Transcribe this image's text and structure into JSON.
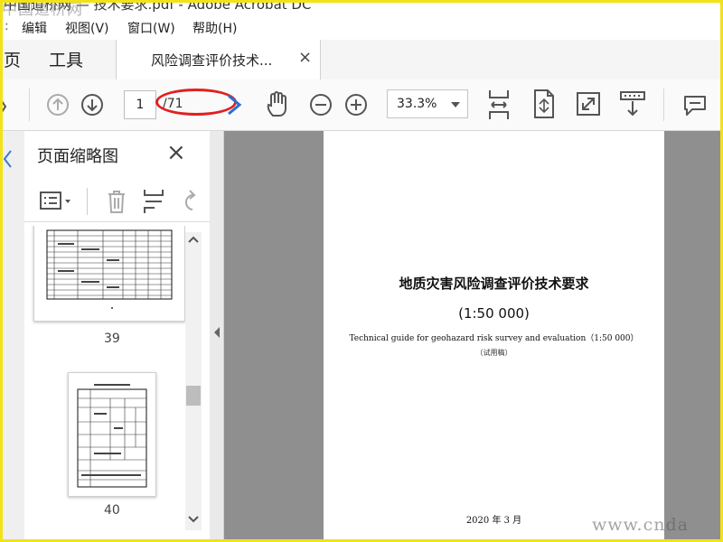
{
  "titlebar": {
    "title_text": "中国道桥网 — 技术要求.pdf - Adobe Acrobat DC",
    "watermark_tl": "中国道桥网"
  },
  "menu": {
    "items": [
      "编辑",
      "视图(V)",
      "窗口(W)",
      "帮助(H)"
    ]
  },
  "tabs": {
    "home": "页",
    "tools": "工具",
    "doc_tab": "风险调查评价技术...",
    "close": "×",
    "help": "?"
  },
  "toolbar": {
    "current_page": "1",
    "total_pages": "/71",
    "zoom": "33.3%"
  },
  "thumbnail_panel": {
    "title": "页面缩略图",
    "close": "×",
    "thumbs": [
      {
        "page": "39"
      },
      {
        "page": "40"
      }
    ]
  },
  "document": {
    "title": "地质灾害风险调查评价技术要求",
    "scale": "(1:50 000)",
    "english_title": "Technical guide for geohazard risk survey and evaluation（1:50 000）",
    "draft": "（试用稿）",
    "date": "2020 年 3 月"
  },
  "watermark_br": "www.cnda",
  "colors": {
    "frame": "#f2e216",
    "annotation": "#e02020",
    "viewer_bg": "#8f8f8f"
  }
}
